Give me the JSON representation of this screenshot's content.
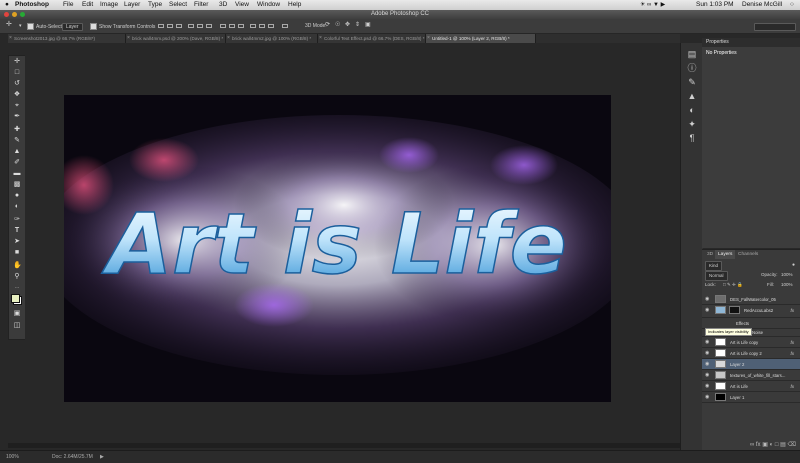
{
  "menubar": {
    "apple": "",
    "app": "Photoshop",
    "items": [
      "File",
      "Edit",
      "Image",
      "Layer",
      "Type",
      "Select",
      "Filter",
      "3D",
      "View",
      "Window",
      "Help"
    ],
    "clock": "Sun 1:03 PM",
    "user": "Denise McGill"
  },
  "window": {
    "title": "Adobe Photoshop CC"
  },
  "options": {
    "auto_select_label": "Auto-Select:",
    "auto_select_value": "Layer",
    "show_transform_label": "Show Transform Controls",
    "mode_3d_label": "3D Mode:"
  },
  "tabs": [
    {
      "label": "Screenshot2013.jpg @ 66.7% (RGB/8*)",
      "active": false
    },
    {
      "label": "brick wall4mm.psd @ 200% (Dave, RGB/8) *",
      "active": false
    },
    {
      "label": "brick wall4mm2.jpg @ 100% (RGB/8) *",
      "active": false
    },
    {
      "label": "Colorful Text Effect.psd @ 66.7% (DES, RGB/8) *",
      "active": false
    },
    {
      "label": "Untitled-1 @ 100% (Layer 2, RGB/8) *",
      "active": true
    }
  ],
  "canvas": {
    "text": "Art is Life"
  },
  "properties": {
    "title": "Properties",
    "subtitle": "No Properties"
  },
  "layers_panel": {
    "tabs": [
      "3D",
      "Layers",
      "Channels"
    ],
    "kind_label": "Kind",
    "mode_label": "Normal",
    "opacity_label": "Opacity:",
    "opacity_value": "100%",
    "lock_label": "Lock:",
    "fill_label": "Fill:",
    "fill_value": "100%",
    "tooltip": "Indicates layer visibility",
    "rows": [
      {
        "name": "DES_FallWatercolor_05",
        "selected": false,
        "fx": false
      },
      {
        "name": "RedAccuLabs2",
        "selected": false,
        "fx": true
      },
      {
        "name": "Effects",
        "selected": false,
        "fx": false
      },
      {
        "name": "Noise",
        "selected": false,
        "fx": false
      },
      {
        "name": "Art is Life copy",
        "selected": false,
        "fx": true
      },
      {
        "name": "Art is Life copy 2",
        "selected": false,
        "fx": true
      },
      {
        "name": "Layer 2",
        "selected": true,
        "fx": false
      },
      {
        "name": "textures_of_white_fill_stars...",
        "selected": false,
        "fx": false
      },
      {
        "name": "Art is Life",
        "selected": false,
        "fx": true
      },
      {
        "name": "Layer 1",
        "selected": false,
        "fx": false
      }
    ]
  },
  "status": {
    "zoom": "100%",
    "doc": "Doc: 2.64M/25.7M"
  },
  "colors": {
    "fg": "#e8f0c0",
    "bg": "#ffffff",
    "accent": "#4f6075"
  }
}
